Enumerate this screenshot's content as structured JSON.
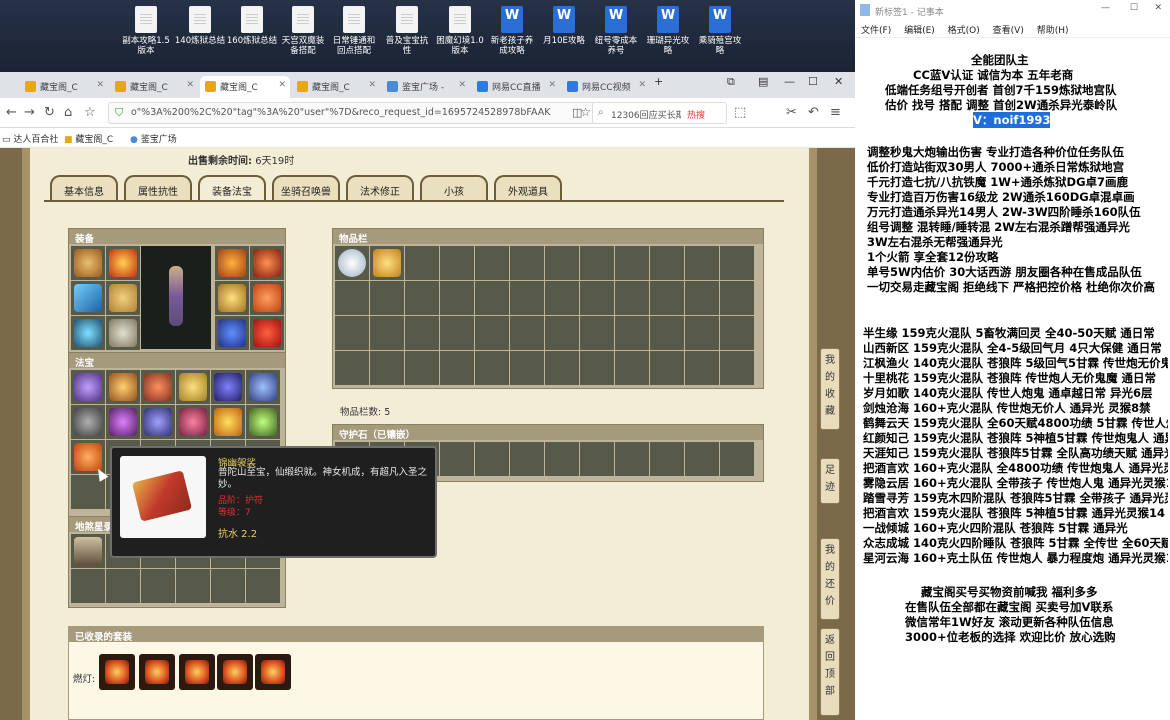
{
  "desktop": {
    "icons": [
      {
        "label": "副本攻略1.5 版本",
        "icon": "doc-icon"
      },
      {
        "label": "140炼狱总结",
        "icon": "doc-icon"
      },
      {
        "label": "160炼狱总结",
        "icon": "doc-icon"
      },
      {
        "label": "天宫双魔装 备搭配",
        "icon": "doc-icon"
      },
      {
        "label": "日常锤通和 回点搭配",
        "icon": "doc-icon"
      },
      {
        "label": "普及宝宝抗 性",
        "icon": "doc-icon"
      },
      {
        "label": "困魔幻境1.0 版本",
        "icon": "doc-icon"
      },
      {
        "label": "新老孩子养 成攻略",
        "icon": "word-icon"
      },
      {
        "label": "月10E攻略",
        "icon": "word-icon"
      },
      {
        "label": "纽号零成本 养号",
        "icon": "word-icon"
      },
      {
        "label": "珊瑚异光攻 略",
        "icon": "word-icon"
      },
      {
        "label": "乘骑殖宫攻 略",
        "icon": "word-icon"
      }
    ]
  },
  "browser": {
    "tabs": [
      {
        "label": "藏宝阁_C"
      },
      {
        "label": "藏宝阁_C"
      },
      {
        "label": "藏宝阁_C"
      },
      {
        "label": "藏宝阁_C"
      },
      {
        "label": "鉴宝广场 -"
      },
      {
        "label": "网易CC直播"
      },
      {
        "label": "网易CC视频"
      }
    ],
    "url": "o\"%3A%200%2C%20\"tag\"%3A%20\"user\"%7D&reco_request_id=1695724528978bFAAK",
    "search_text": "12306回应买长期",
    "search_hot": "热搜",
    "bookmarks": [
      "达人百合社",
      "藏宝阁_C",
      "鉴宝广场"
    ]
  },
  "game": {
    "remaining_label": "出售剩余时间:",
    "remaining_value": "6天19时",
    "tabs": [
      "基本信息",
      "属性抗性",
      "装备法宝",
      "坐骑召唤兽",
      "法术修正",
      "小孩",
      "外观道具"
    ],
    "active_tab": "装备法宝",
    "equip_header": "装备",
    "fabao_header": "法宝",
    "dipan_header": "地煞星录",
    "items_header": "物品栏",
    "items_count_label": "物品栏数:",
    "items_count": "5",
    "guard_header": "守护石（已镶嵌）",
    "collected_header": "已收录的套装",
    "collected_label": "燃灯:",
    "side_buttons": [
      "我的收藏",
      "足迹",
      "我的还价",
      "返回顶部"
    ],
    "tooltip": {
      "name": "锦幽袈裟",
      "desc": "普陀山至宝，仙缎织就。神女机成，有超凡入圣之妙。",
      "line1": "品阶：护符",
      "line2": "等级：7",
      "resist": "抗水 2.2"
    }
  },
  "notepad": {
    "title": "新标签1 - 记事本",
    "menu": [
      "文件(F)",
      "编辑(E)",
      "格式(O)",
      "查看(V)",
      "帮助(H)"
    ],
    "lines": [
      "全能团队主",
      "CC蓝V认证 诚信为本 五年老商",
      "低端任务组号开创者          首创7千159炼狱地宫队",
      "估价 找号 搭配 调整          首创2W通杀异光泰岭队",
      "V：noif1993",
      "",
      "调整秒鬼大炮输出伤害          专业打造各种价位任务队伍",
      "低价打造站街双30男人            7000+通杀日常炼狱地宫",
      "千元打造七抗/八抗铁魔           1W+通杀炼狱DG卓7画鹿",
      "专业打造百万伤害16级龙          2W通杀160DG卓混卓画",
      "万元打造通杀异光14男人        2W-3W四阶睡杀160队伍",
      "组号调整 混转睡/睡转混          2W左右混杀蹭帮强通异光",
      "                                        3W左右混杀无帮强通异光",
      "1个火箭 享全套12份攻略",
      "单号5W内估价 30大话西游        朋友圈各种在售成品队伍",
      "一切交易走藏宝阁 拒绝线下     严格把控价格 杜绝你次价高",
      "",
      "半生缘    159克火混队  5畜牧满回灵 全40-50天赋 通日常",
      "山西新区  159克火混队  全4-5级回气月 4只大保健 通日常",
      "江枫渔火  140克火混队  苍狼阵  5级回气5甘霖 传世炮无价鬼人",
      "十里桃花  159克火混队  苍狼阵 传世炮人无价鬼魔 通日常",
      "岁月如歌  140克火混队  传世人炮鬼 通卓越日常 异光6层",
      "剑烛沧海  160+克火混队 传世炮无价人 通异光 灵猴8禁",
      "鹤舞云天  159克火混队  全60天赋4800功绩 5甘霖 传世人炮",
      "红颜知己  159克火混队  苍狼阵  5神植5甘霖 传世炮鬼人 通异光",
      "天涯知己  159克火混队  苍狼阵5甘霖 全队高功绩天赋 通异光",
      "把酒言欢  160+克火混队 全4800功绩 传世炮鬼人 通异光灵猴",
      "雾隐云居  160+克火混队 全带孩子 传世炮人鬼 通异光灵猴14",
      "踏雪寻芳  159克木四阶混队 苍狼阵5甘霖 全带孩子 通异光灵猴",
      "把酒言欢  159克火混队  苍狼阵  5神植5甘霖 通异光灵猴14",
      "一战倾城  160+克火四阶混队 苍狼阵 5甘霖 通异光",
      "众志成城  140克火四阶睡队 苍狼阵 5甘霖 全传世 全60天赋",
      "星河云海  160+克土队伍 传世炮人 暴力程度炮 通异光灵猴14",
      "",
      "藏宝阁买号买物资前喊我 福利多多",
      "在售队伍全部都在藏宝阁 买卖号加V联系",
      "微信常年1W好友 滚动更新各种队伍信息",
      "3000+位老板的选择 欢迎比价 放心选购"
    ]
  }
}
